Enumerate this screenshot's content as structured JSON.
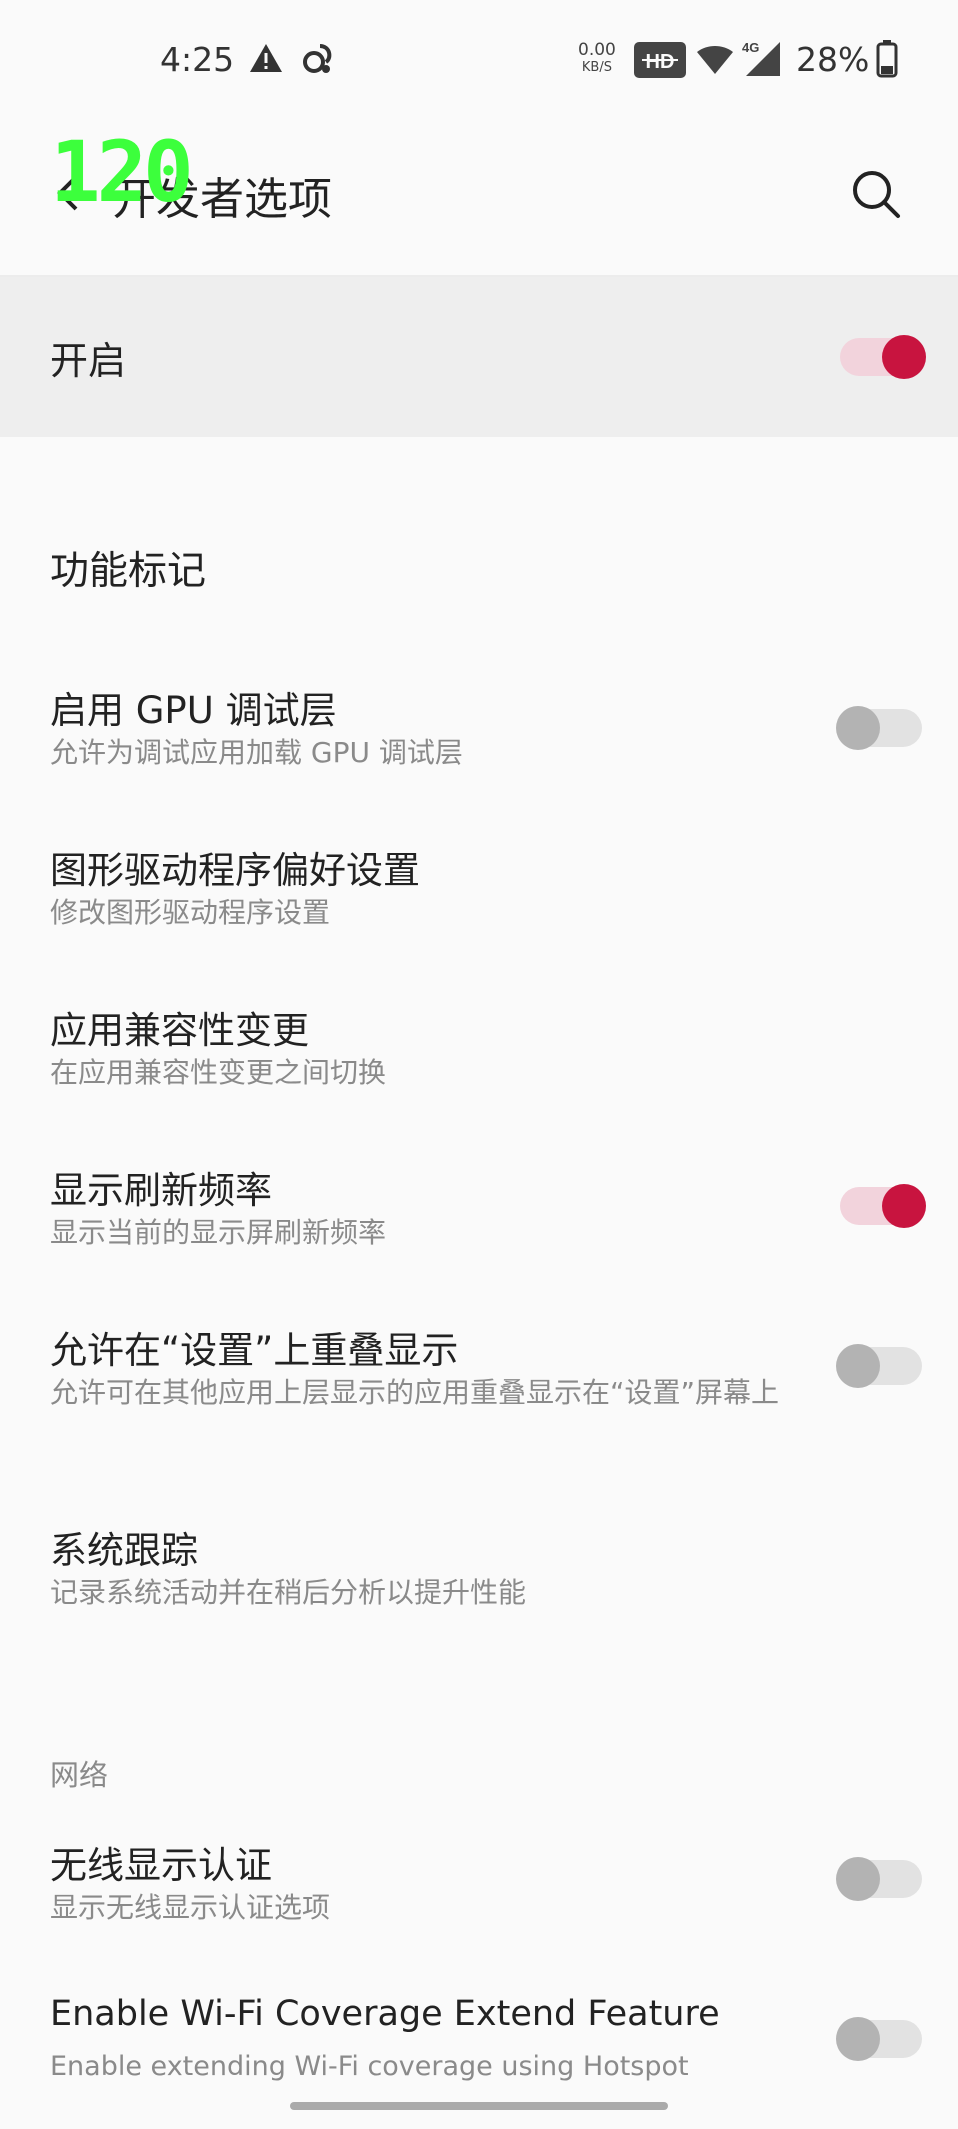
{
  "status_bar": {
    "time": "4:25",
    "net_speed_value": "0.00",
    "net_speed_unit": "KB/S",
    "hd_badge": "HD",
    "network_type": "4G",
    "battery_percent": "28%",
    "icons": [
      "alert-triangle-icon",
      "squirrel-app-icon",
      "hd-voice-icon",
      "wifi-icon",
      "cell-signal-icon",
      "battery-icon"
    ]
  },
  "overlay": {
    "fps": "120"
  },
  "header": {
    "title": "开发者选项",
    "back_icon": "chevron-left-icon",
    "search_icon": "search-icon"
  },
  "master": {
    "label": "开启",
    "enabled": true
  },
  "section": {
    "title": "功能标记"
  },
  "items": [
    {
      "title": "启用 GPU 调试层",
      "subtitle": "允许为调试应用加载 GPU 调试层",
      "toggle": "off"
    },
    {
      "title": "图形驱动程序偏好设置",
      "subtitle": "修改图形驱动程序设置",
      "toggle": "none"
    },
    {
      "title": "应用兼容性变更",
      "subtitle": "在应用兼容性变更之间切换",
      "toggle": "none"
    },
    {
      "title": "显示刷新频率",
      "subtitle": "显示当前的显示屏刷新频率",
      "toggle": "on"
    },
    {
      "title": "允许在“设置”上重叠显示",
      "subtitle": "允许可在其他应用上层显示的应用重叠显示在“设置”屏幕上",
      "toggle": "off"
    },
    {
      "title": "系统跟踪",
      "subtitle": "记录系统活动并在稍后分析以提升性能",
      "toggle": "none"
    }
  ],
  "network_category": {
    "label": "网络",
    "items": [
      {
        "title": "无线显示认证",
        "subtitle": "显示无线显示认证选项",
        "toggle": "off"
      },
      {
        "title": "Enable Wi-Fi Coverage Extend Feature",
        "subtitle": "Enable extending Wi-Fi coverage using Hotspot",
        "toggle": "off"
      }
    ]
  },
  "colors": {
    "accent": "#c8143f",
    "accent_track": "#f2d3dc",
    "fps_overlay": "#3cff3c",
    "background": "#fafafa",
    "master_row_bg": "#eeeeee"
  }
}
